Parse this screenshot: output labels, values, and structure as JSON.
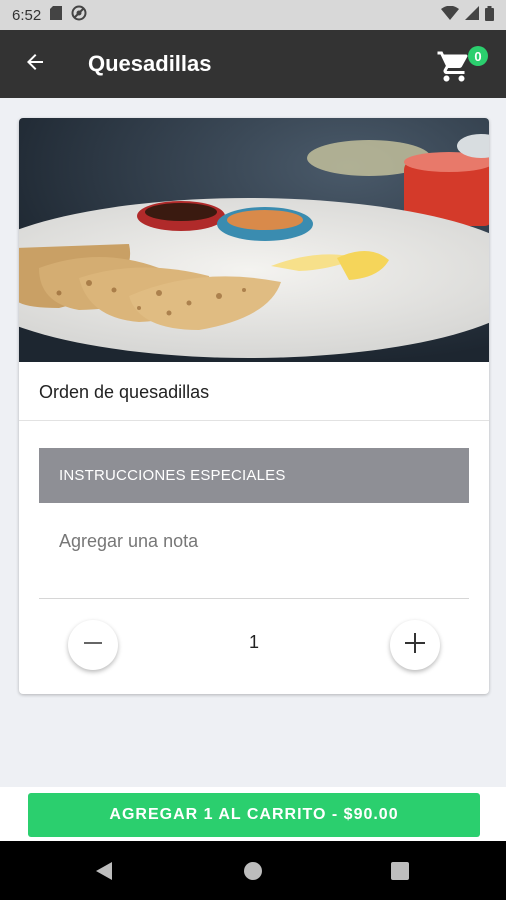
{
  "status_bar": {
    "time": "6:52",
    "left_icons": [
      "sd-card-icon",
      "dnd-icon"
    ],
    "right_icons": [
      "wifi-icon",
      "signal-icon",
      "battery-icon"
    ]
  },
  "app_bar": {
    "title": "Quesadillas",
    "back_icon": "arrow-back-icon",
    "cart_icon": "shopping-cart-icon",
    "cart_count": "0"
  },
  "item": {
    "image_description": "quesadillas-photo",
    "name": "Orden de quesadillas"
  },
  "instructions": {
    "header": "INSTRUCCIONES ESPECIALES",
    "note_value": "",
    "note_placeholder": "Agregar una nota"
  },
  "quantity": {
    "value": "1",
    "minus_icon": "minus-icon",
    "plus_icon": "plus-icon"
  },
  "add_button": {
    "label": "AGREGAR 1 AL CARRITO - $90.00"
  },
  "nav_bar": {
    "icons": [
      "back-triangle-icon",
      "home-circle-icon",
      "recents-square-icon"
    ]
  },
  "colors": {
    "app_bar": "#333333",
    "accent_green": "#2bcf6e",
    "section_header": "#8e8f95",
    "background": "#eef0f4"
  }
}
